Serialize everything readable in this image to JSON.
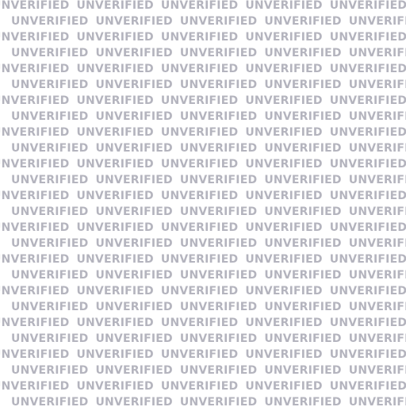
{
  "watermark": {
    "text": "UNVERIFIED",
    "color": "#b4b4be"
  }
}
